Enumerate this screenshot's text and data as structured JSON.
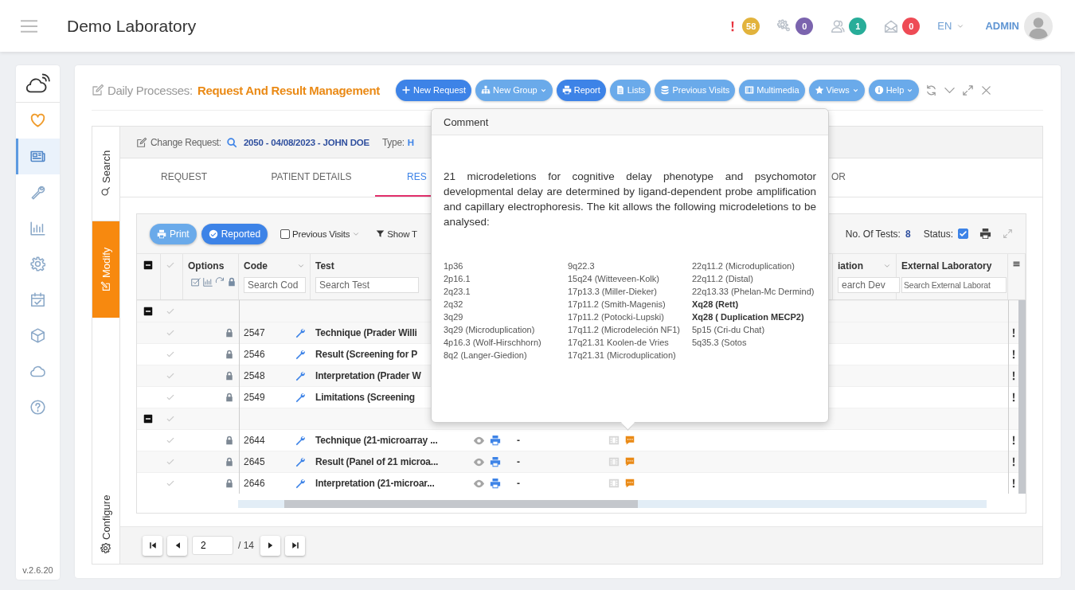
{
  "header": {
    "title": "Demo Laboratory",
    "alerts": [
      {
        "count": "58",
        "color": "#e2b33c"
      },
      {
        "count": "0",
        "color": "#7b64ae"
      },
      {
        "count": "1",
        "color": "#28ad99"
      },
      {
        "count": "0",
        "color": "#ee4b55"
      }
    ],
    "language": "EN",
    "user": "ADMIN"
  },
  "sidebar": {
    "items": [
      {
        "selected": false
      },
      {
        "selected": true
      },
      {
        "selected": false
      },
      {
        "selected": false
      },
      {
        "selected": false
      },
      {
        "selected": false
      },
      {
        "selected": false
      },
      {
        "selected": false
      },
      {
        "selected": false
      }
    ],
    "version": "v.2.6.20"
  },
  "page": {
    "section": "Daily Processes:",
    "title": "Request And Result Management",
    "buttons": [
      {
        "label": "New Request",
        "kind": "primary",
        "dropdown": false
      },
      {
        "label": "New Group",
        "kind": "secondary",
        "dropdown": true
      },
      {
        "label": "Report",
        "kind": "primary",
        "dropdown": false
      },
      {
        "label": "Lists",
        "kind": "secondary",
        "dropdown": false
      },
      {
        "label": "Previous Visits",
        "kind": "secondary",
        "dropdown": false
      },
      {
        "label": "Multimedia",
        "kind": "secondary",
        "dropdown": false
      },
      {
        "label": "Views",
        "kind": "secondary",
        "dropdown": true
      },
      {
        "label": "Help",
        "kind": "secondary",
        "dropdown": true
      }
    ]
  },
  "side_tabs": [
    {
      "label": "Search",
      "selected": false
    },
    {
      "label": "Modify",
      "selected": true
    },
    {
      "label": "Configure",
      "selected": false
    }
  ],
  "request": {
    "label": "Change Request:",
    "value": "2050 - 04/08/2023 - JOHN DOE",
    "type_label": "Type:",
    "type_value": "H"
  },
  "tabs": [
    {
      "label": "REQUEST",
      "selected": false
    },
    {
      "label": "PATIENT DETAILS",
      "selected": false
    },
    {
      "label": "RES",
      "selected": true
    },
    {
      "label": "OR",
      "selected": false
    }
  ],
  "table": {
    "toolbar": {
      "print": "Print",
      "reported": "Reported",
      "previous_visits": "Previous Visits",
      "previous_visits_checked": false,
      "show": "Show T",
      "tests_label": "No. Of Tests:",
      "tests_count": "8",
      "status_label": "Status:",
      "status_checked": true
    },
    "columns": {
      "options": "Options",
      "code": "Code",
      "code_placeholder": "Search Cod",
      "test": "Test",
      "test_placeholder": "Search Test",
      "deviation": "iation",
      "deviation_placeholder": "earch Dev",
      "external": "External Laboratory",
      "external_placeholder": "Search External Laborat"
    },
    "rows": [
      {
        "kind": "group",
        "expanded": true
      },
      {
        "kind": "test",
        "code": "2547",
        "test": "Technique (Prader Willi",
        "locked": true,
        "flagged": true
      },
      {
        "kind": "test",
        "code": "2546",
        "test": "Result (Screening for P",
        "locked": true,
        "flagged": true
      },
      {
        "kind": "test",
        "code": "2548",
        "test": "Interpretation (Prader W",
        "locked": true,
        "flagged": true
      },
      {
        "kind": "test",
        "code": "2549",
        "test": "Limitations (Screening",
        "locked": true,
        "flagged": true
      },
      {
        "kind": "group",
        "expanded": true
      },
      {
        "kind": "test",
        "code": "2644",
        "test": "Technique (21-microarray ...",
        "locked": true,
        "flagged": true,
        "result": "-"
      },
      {
        "kind": "test",
        "code": "2645",
        "test": "Result (Panel of 21 microa...",
        "locked": true,
        "flagged": true,
        "result": "-"
      },
      {
        "kind": "test",
        "code": "2646",
        "test": "Interpretation (21-microar...",
        "locked": true,
        "flagged": true,
        "result": "-"
      }
    ]
  },
  "pagination": {
    "page": "2",
    "total": "/ 14"
  },
  "popup": {
    "title": "Comment",
    "text": "21 microdeletions for cognitive delay phenotype and psychomotor developmental delay are determined by ligand-dependent probe amplification and capillary electrophoresis. The kit allows the following microdeletions to be analysed:",
    "rows": [
      [
        {
          "text": "1p36",
          "bold": false
        },
        {
          "text": "9q22.3",
          "bold": false
        },
        {
          "text": "22q11.2 (Microduplication)",
          "bold": false
        }
      ],
      [
        {
          "text": "2p16.1",
          "bold": false
        },
        {
          "text": "15q24 (Witteveen-Kolk)",
          "bold": false
        },
        {
          "text": "22q11.2  (Distal)",
          "bold": false
        }
      ],
      [
        {
          "text": "2q23.1",
          "bold": false
        },
        {
          "text": "17p13.3 (Miller-Dieker)",
          "bold": false
        },
        {
          "text": "22q13.33 (Phelan-Mc Dermind)",
          "bold": false
        }
      ],
      [
        {
          "text": "2q32",
          "bold": false
        },
        {
          "text": "17p11.2 (Smith-Magenis)",
          "bold": false
        },
        {
          "text": "Xq28 (Rett)",
          "bold": true
        }
      ],
      [
        {
          "text": "3q29",
          "bold": false
        },
        {
          "text": "17p11.2 (Potocki-Lupski)",
          "bold": false
        },
        {
          "text": "Xq28 ( Duplication MECP2)",
          "bold": true
        }
      ],
      [
        {
          "text": "3q29 (Microduplication)",
          "bold": false
        },
        {
          "text": "17q11.2 (Microdeleción NF1)",
          "bold": false
        },
        {
          "text": "5p15 (Cri-du Chat)",
          "bold": false
        }
      ],
      [
        {
          "text": "4p16.3 (Wolf-Hirschhorn)",
          "bold": false
        },
        {
          "text": "17q21.31 Koolen-de Vries",
          "bold": false
        },
        {
          "text": "5q35.3 (Sotos",
          "bold": false
        }
      ],
      [
        {
          "text": "8q2 (Langer-Giedion)",
          "bold": false
        },
        {
          "text": "17q21.31 (Microduplication)",
          "bold": false
        }
      ]
    ]
  }
}
